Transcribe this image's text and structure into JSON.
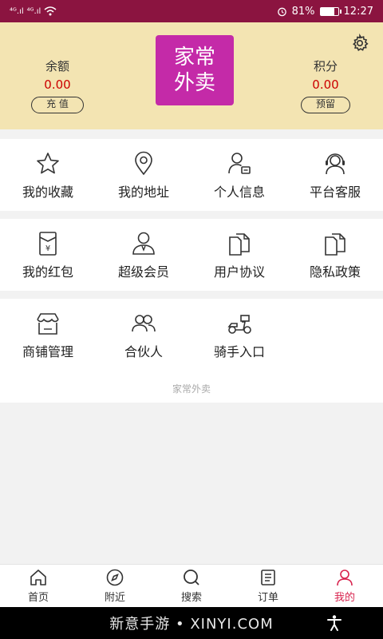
{
  "status_bar": {
    "signal_1": "⁴ᴳ.ıl",
    "signal_2": "⁴ᴳ.ıl",
    "battery_percent": "81%",
    "battery_level": 0.81,
    "time": "12:27",
    "icons": [
      "signal-icon",
      "signal-icon",
      "wifi-icon",
      "alarm-icon",
      "battery-icon"
    ]
  },
  "header": {
    "logo_text": "家常\n外卖",
    "balance": {
      "label": "余额",
      "value": "0.00",
      "button": "充 值"
    },
    "points": {
      "label": "积分",
      "value": "0.00",
      "button": "预留"
    },
    "settings_icon": "gear-icon",
    "colors": {
      "background": "#f3e4b2",
      "logo": "#c42aa8",
      "value": "#cc0000"
    }
  },
  "menu": {
    "row1": [
      {
        "label": "我的收藏",
        "icon": "star-icon"
      },
      {
        "label": "我的地址",
        "icon": "location-pin-icon"
      },
      {
        "label": "个人信息",
        "icon": "profile-card-icon"
      },
      {
        "label": "平台客服",
        "icon": "headset-icon"
      }
    ],
    "row2": [
      {
        "label": "我的红包",
        "icon": "red-envelope-icon"
      },
      {
        "label": "超级会员",
        "icon": "vip-user-icon"
      },
      {
        "label": "用户协议",
        "icon": "document-icon"
      },
      {
        "label": "隐私政策",
        "icon": "document-icon"
      }
    ],
    "row3": [
      {
        "label": "商铺管理",
        "icon": "shop-icon"
      },
      {
        "label": "合伙人",
        "icon": "partners-icon"
      },
      {
        "label": "骑手入口",
        "icon": "scooter-icon"
      }
    ],
    "footer": "家常外卖"
  },
  "tab_bar": {
    "tabs": [
      {
        "label": "首页",
        "icon": "home-icon"
      },
      {
        "label": "附近",
        "icon": "compass-icon"
      },
      {
        "label": "搜索",
        "icon": "search-icon"
      },
      {
        "label": "订单",
        "icon": "order-list-icon"
      },
      {
        "label": "我的",
        "icon": "user-icon"
      }
    ],
    "active": "我的",
    "active_color": "#d8234e"
  },
  "nav_bar": {
    "watermark": "新意手游 • XINYI.COM"
  }
}
